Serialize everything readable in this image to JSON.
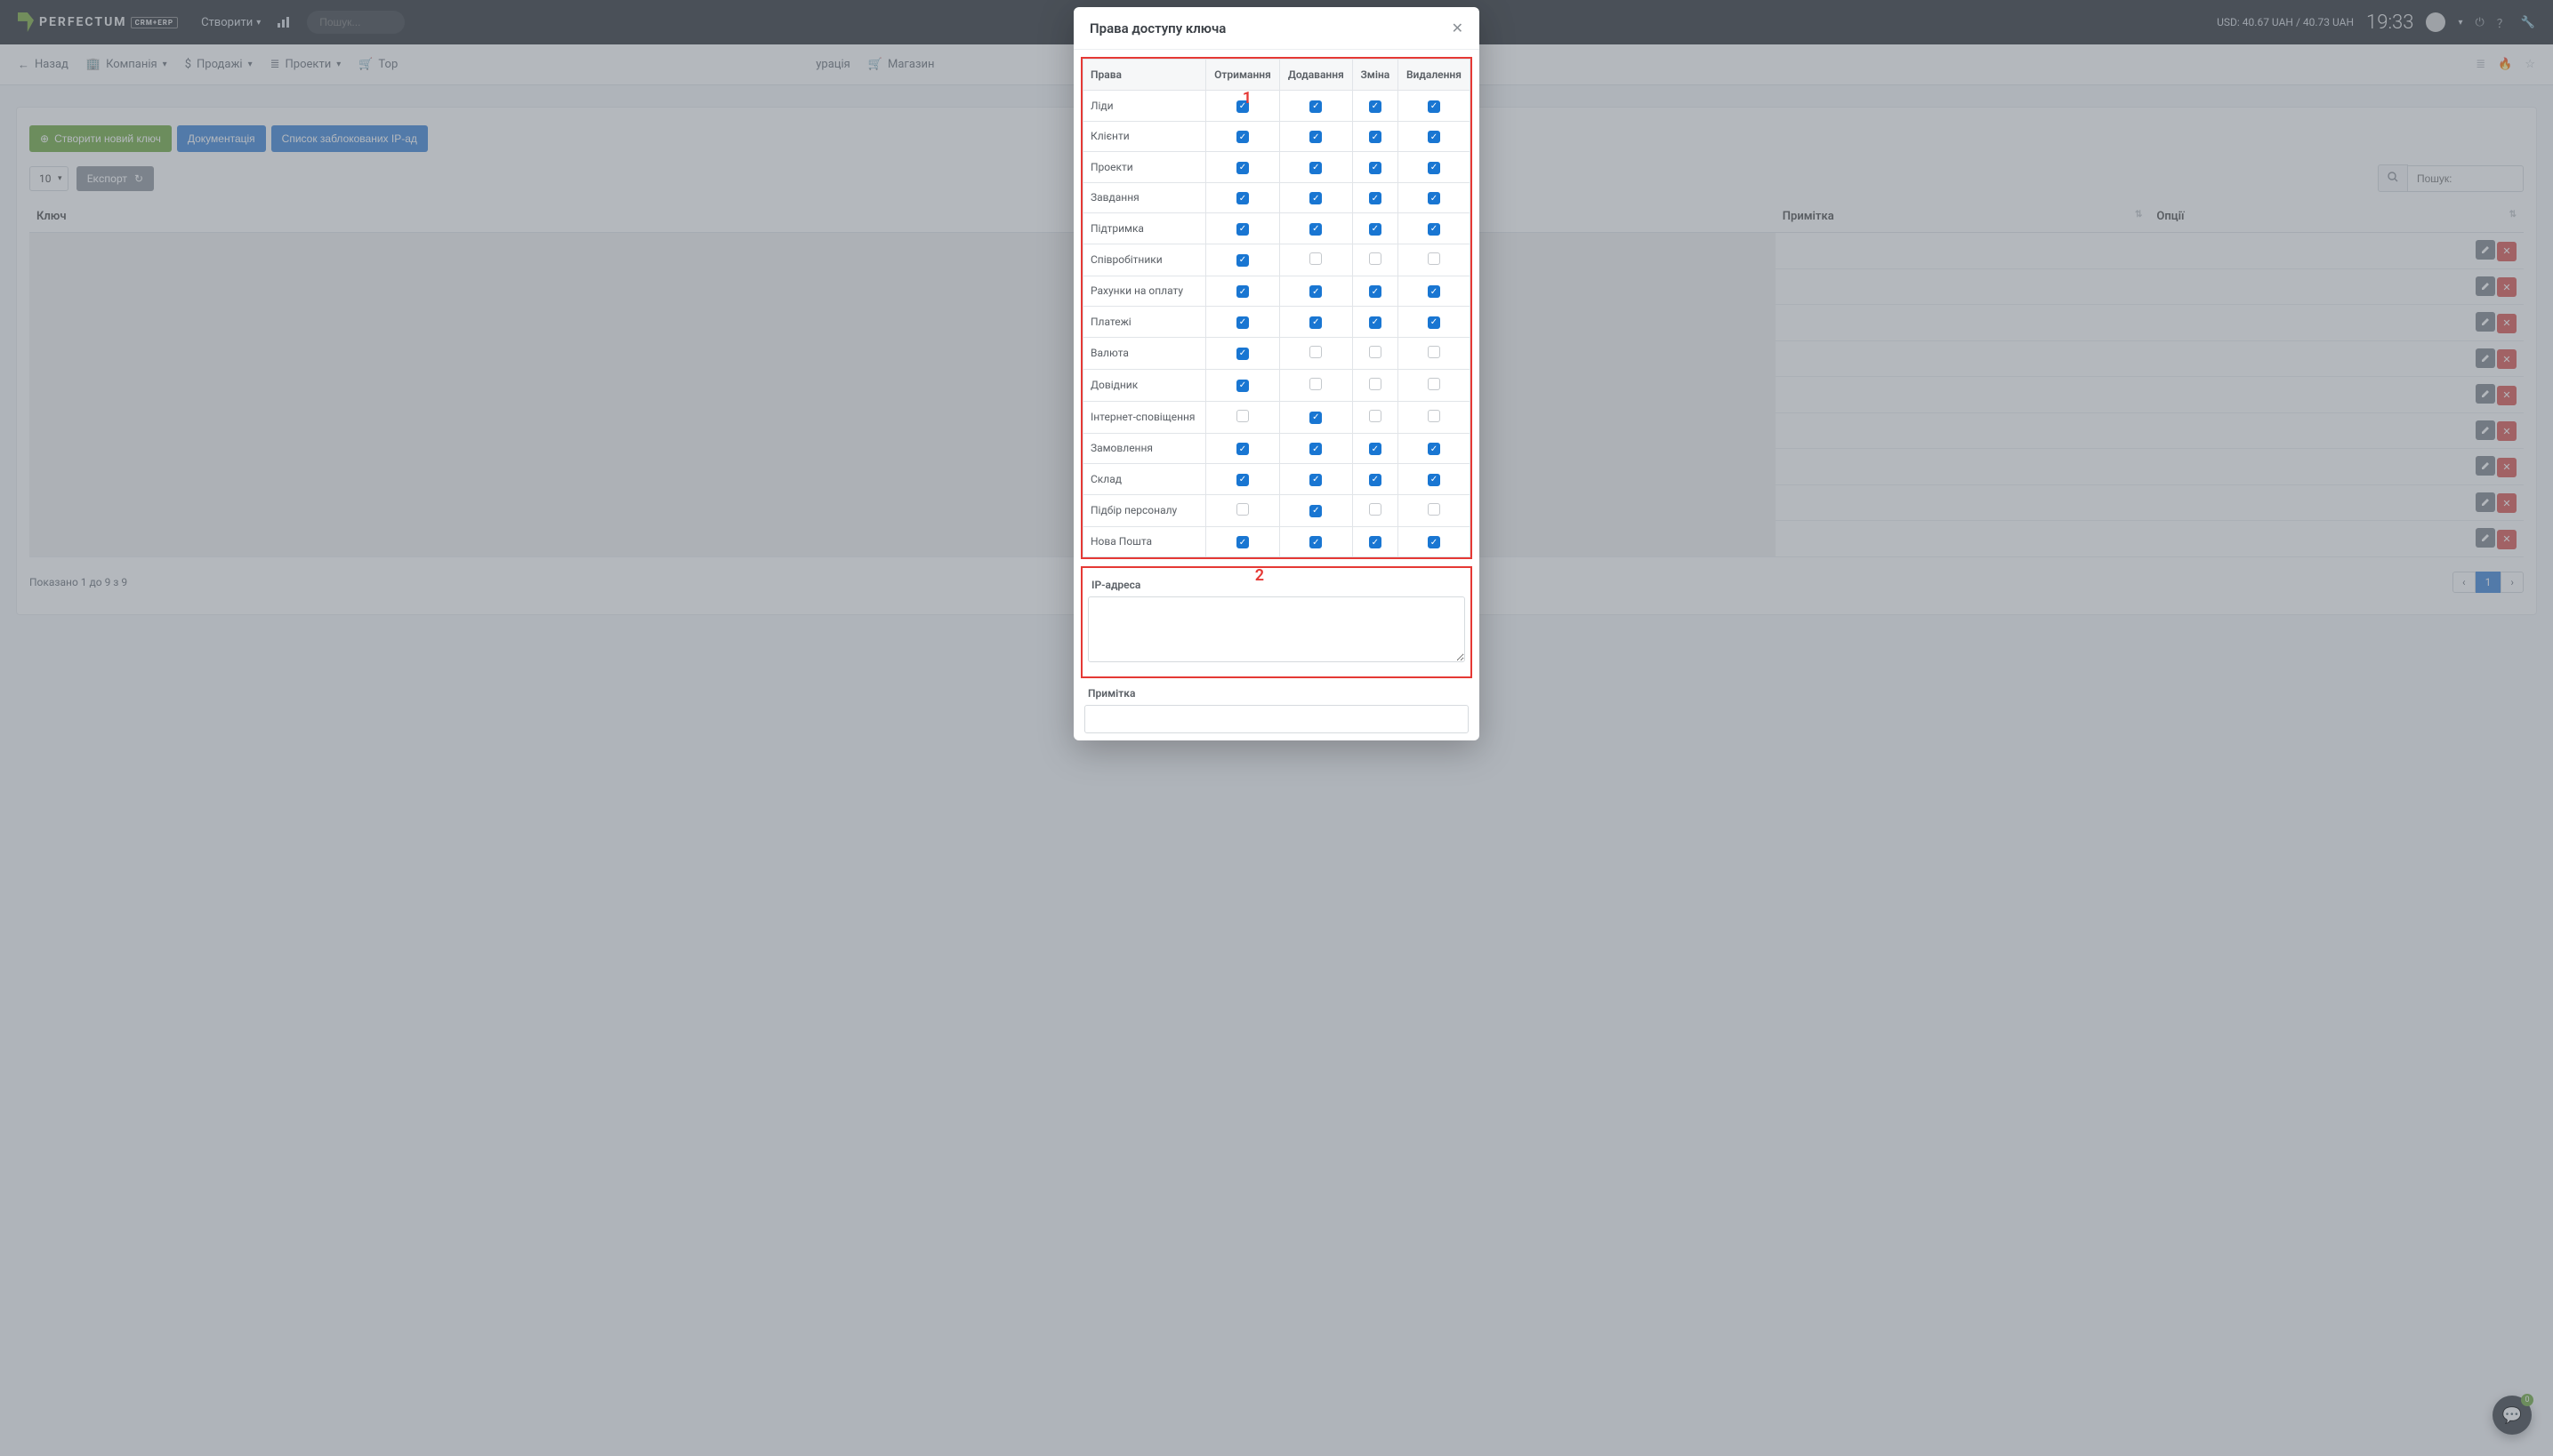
{
  "topbar": {
    "logo_text": "PERFECTUM",
    "logo_sub": "CRM+ERP",
    "create_label": "Створити",
    "search_placeholder": "Пошук...",
    "currency_text": "USD: 40.67 UAH / 40.73 UAH",
    "clock": "19:33"
  },
  "nav": {
    "back": "Назад",
    "items": [
      {
        "label": "Компанія",
        "icon": "🏢",
        "chev": true
      },
      {
        "label": "Продажі",
        "icon": "$",
        "chev": true
      },
      {
        "label": "Проекти",
        "icon": "≣",
        "chev": true
      },
      {
        "label": "Тор",
        "icon": "🛒",
        "chev": false
      },
      {
        "label": "урація",
        "icon": "",
        "chev": false
      },
      {
        "label": "Магазин",
        "icon": "🛒",
        "chev": false
      }
    ]
  },
  "actions": {
    "create_key": "Створити новий ключ",
    "docs": "Документація",
    "blocked_ip": "Список заблокованих IP-ад",
    "export": "Експорт",
    "page_size": "10"
  },
  "search": {
    "placeholder": "Пошук:"
  },
  "table": {
    "headers": {
      "key": "Ключ",
      "note": "Примітка",
      "opts": "Опції"
    },
    "row_count": 9
  },
  "footer": {
    "info": "Показано 1 до 9 з 9",
    "page": "1"
  },
  "modal": {
    "title": "Права доступу ключа",
    "cols": [
      "Права",
      "Отримання",
      "Додавання",
      "Зміна",
      "Видалення"
    ],
    "rows": [
      {
        "label": "Ліди",
        "c": [
          1,
          1,
          1,
          1
        ]
      },
      {
        "label": "Клієнти",
        "c": [
          1,
          1,
          1,
          1
        ]
      },
      {
        "label": "Проекти",
        "c": [
          1,
          1,
          1,
          1
        ]
      },
      {
        "label": "Завдання",
        "c": [
          1,
          1,
          1,
          1
        ]
      },
      {
        "label": "Підтримка",
        "c": [
          1,
          1,
          1,
          1
        ]
      },
      {
        "label": "Співробітники",
        "c": [
          1,
          0,
          0,
          0
        ]
      },
      {
        "label": "Рахунки на оплату",
        "c": [
          1,
          1,
          1,
          1
        ]
      },
      {
        "label": "Платежі",
        "c": [
          1,
          1,
          1,
          1
        ]
      },
      {
        "label": "Валюта",
        "c": [
          1,
          0,
          0,
          0
        ]
      },
      {
        "label": "Довідник",
        "c": [
          1,
          0,
          0,
          0
        ]
      },
      {
        "label": "Інтернет-сповіщення",
        "c": [
          0,
          1,
          0,
          0
        ]
      },
      {
        "label": "Замовлення",
        "c": [
          1,
          1,
          1,
          1
        ]
      },
      {
        "label": "Склад",
        "c": [
          1,
          1,
          1,
          1
        ]
      },
      {
        "label": "Підбір персоналу",
        "c": [
          0,
          1,
          0,
          0
        ]
      },
      {
        "label": "Нова Пошта",
        "c": [
          1,
          1,
          1,
          1
        ]
      }
    ],
    "annot1": "1",
    "annot2": "2",
    "ip_label": "IP-адреса",
    "note_label": "Примітка"
  },
  "fab": {
    "badge": "0"
  }
}
